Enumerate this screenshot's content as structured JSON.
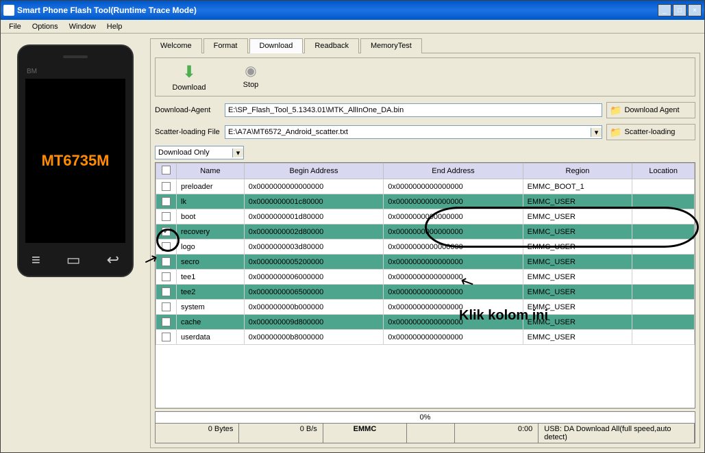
{
  "title": "Smart Phone Flash Tool(Runtime Trace Mode)",
  "menu": [
    "File",
    "Options",
    "Window",
    "Help"
  ],
  "phone": {
    "bm": "BM",
    "screen": "MT6735M"
  },
  "tabs": [
    "Welcome",
    "Format",
    "Download",
    "Readback",
    "MemoryTest"
  ],
  "active_tab": 2,
  "toolbar": {
    "download": "Download",
    "stop": "Stop"
  },
  "form": {
    "da_label": "Download-Agent",
    "da_value": "E:\\SP_Flash_Tool_5.1343.01\\MTK_AllInOne_DA.bin",
    "da_btn": "Download Agent",
    "scatter_label": "Scatter-loading File",
    "scatter_value": "E:\\A7A\\MT6572_Android_scatter.txt",
    "scatter_btn": "Scatter-loading",
    "mode": "Download Only"
  },
  "cols": [
    "",
    "Name",
    "Begin Address",
    "End Address",
    "Region",
    "Location"
  ],
  "rows": [
    {
      "chk": false,
      "name": "preloader",
      "begin": "0x0000000000000000",
      "end": "0x0000000000000000",
      "region": "EMMC_BOOT_1",
      "loc": ""
    },
    {
      "chk": false,
      "name": "lk",
      "begin": "0x0000000001c80000",
      "end": "0x0000000000000000",
      "region": "EMMC_USER",
      "loc": ""
    },
    {
      "chk": false,
      "name": "boot",
      "begin": "0x0000000001d80000",
      "end": "0x0000000000000000",
      "region": "EMMC_USER",
      "loc": ""
    },
    {
      "chk": true,
      "name": "recovery",
      "begin": "0x0000000002d80000",
      "end": "0x0000000000000000",
      "region": "EMMC_USER",
      "loc": ""
    },
    {
      "chk": false,
      "name": "logo",
      "begin": "0x0000000003d80000",
      "end": "0x0000000000000000",
      "region": "EMMC_USER",
      "loc": ""
    },
    {
      "chk": false,
      "name": "secro",
      "begin": "0x0000000005200000",
      "end": "0x0000000000000000",
      "region": "EMMC_USER",
      "loc": ""
    },
    {
      "chk": false,
      "name": "tee1",
      "begin": "0x0000000006000000",
      "end": "0x0000000000000000",
      "region": "EMMC_USER",
      "loc": ""
    },
    {
      "chk": false,
      "name": "tee2",
      "begin": "0x0000000006500000",
      "end": "0x0000000000000000",
      "region": "EMMC_USER",
      "loc": ""
    },
    {
      "chk": false,
      "name": "system",
      "begin": "0x000000000b000000",
      "end": "0x0000000000000000",
      "region": "EMMC_USER",
      "loc": ""
    },
    {
      "chk": false,
      "name": "cache",
      "begin": "0x000000009d800000",
      "end": "0x0000000000000000",
      "region": "EMMC_USER",
      "loc": ""
    },
    {
      "chk": false,
      "name": "userdata",
      "begin": "0x00000000b8000000",
      "end": "0x0000000000000000",
      "region": "EMMC_USER",
      "loc": ""
    }
  ],
  "progress": "0%",
  "status": {
    "bytes": "0 Bytes",
    "speed": "0 B/s",
    "storage": "EMMC",
    "time": "0:00",
    "usb": "USB: DA Download All(full speed,auto detect)"
  },
  "annotation_text": "Klik kolom ini"
}
